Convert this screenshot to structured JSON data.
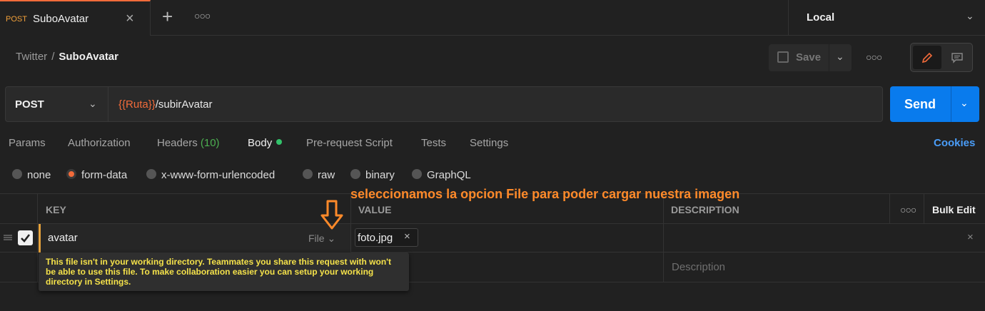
{
  "tab": {
    "method": "POST",
    "title": "SuboAvatar"
  },
  "environment": {
    "label": "Local"
  },
  "breadcrumb": {
    "parent": "Twitter",
    "separator": "/",
    "current": "SuboAvatar"
  },
  "toolbar": {
    "save_label": "Save"
  },
  "request": {
    "method": "POST",
    "url_variable": "{{Ruta}}",
    "url_path": "/subirAvatar",
    "send_label": "Send"
  },
  "request_tabs": {
    "params": "Params",
    "authorization": "Authorization",
    "headers": "Headers",
    "headers_count": "(10)",
    "body": "Body",
    "prerequest": "Pre-request Script",
    "tests": "Tests",
    "settings": "Settings",
    "cookies": "Cookies"
  },
  "body_types": {
    "none": "none",
    "form_data": "form-data",
    "urlencoded": "x-www-form-urlencoded",
    "raw": "raw",
    "binary": "binary",
    "graphql": "GraphQL",
    "selected": "form-data"
  },
  "annotation": "seleccionamos la opcion File para poder cargar nuestra imagen",
  "table": {
    "headers": {
      "key": "KEY",
      "value": "VALUE",
      "description": "DESCRIPTION",
      "bulk_edit": "Bulk Edit"
    },
    "rows": [
      {
        "key": "avatar",
        "type": "File",
        "value": "foto.jpg",
        "checked": true
      }
    ],
    "description_placeholder": "Description"
  },
  "tooltip": "This file isn't in your working directory. Teammates you share this request with won't be able to use this file. To make collaboration easier you can setup your working directory in Settings.",
  "colors": {
    "accent": "#f26b3a",
    "send": "#097bed",
    "annotation": "#ff8a2a",
    "tooltip_text": "#f5e24a"
  }
}
